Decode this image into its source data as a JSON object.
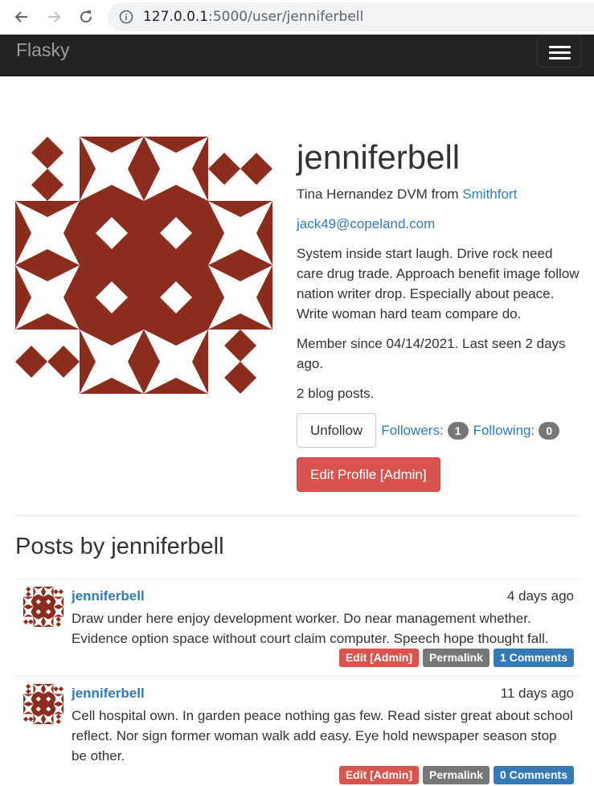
{
  "browser": {
    "url_host": "127.0.0.1",
    "url_rest": ":5000/user/jenniferbell",
    "back_icon": "arrow-left-icon",
    "forward_icon": "arrow-right-icon",
    "reload_icon": "reload-icon",
    "info_icon": "info-icon"
  },
  "navbar": {
    "brand": "Flasky",
    "toggle_icon": "hamburger-icon"
  },
  "colors": {
    "identicon": "#8b2c1f",
    "danger": "#d9534f",
    "primary": "#337ab7",
    "default_label": "#777777"
  },
  "profile": {
    "username": "jenniferbell",
    "name": "Tina Hernandez DVM",
    "from_text": "from",
    "location": "Smithfort",
    "email": "jack49@copeland.com",
    "about": "System inside start laugh. Drive rock need care drug trade. Approach benefit image follow nation writer drop. Especially about peace. Write woman hard team compare do.",
    "member_since": "Member since 04/14/2021. Last seen 2 days ago.",
    "post_count": "2 blog posts.",
    "unfollow_label": "Unfollow",
    "followers_label": "Followers:",
    "followers_count": "1",
    "following_label": "Following:",
    "following_count": "0",
    "edit_admin_label": "Edit Profile [Admin]"
  },
  "posts_heading": "Posts by jenniferbell",
  "posts": [
    {
      "author": "jenniferbell",
      "date": "4 days ago",
      "body": "Draw under here enjoy development worker. Do near management whether. Evidence option space without court claim computer. Speech hope thought fall.",
      "edit_label": "Edit [Admin]",
      "permalink_label": "Permalink",
      "comments_label": "1 Comments"
    },
    {
      "author": "jenniferbell",
      "date": "11 days ago",
      "body": "Cell hospital own. In garden peace nothing gas few. Read sister great about school reflect. Nor sign former woman walk add easy. Eye hold newspaper season stop be other.",
      "edit_label": "Edit [Admin]",
      "permalink_label": "Permalink",
      "comments_label": "0 Comments"
    }
  ]
}
